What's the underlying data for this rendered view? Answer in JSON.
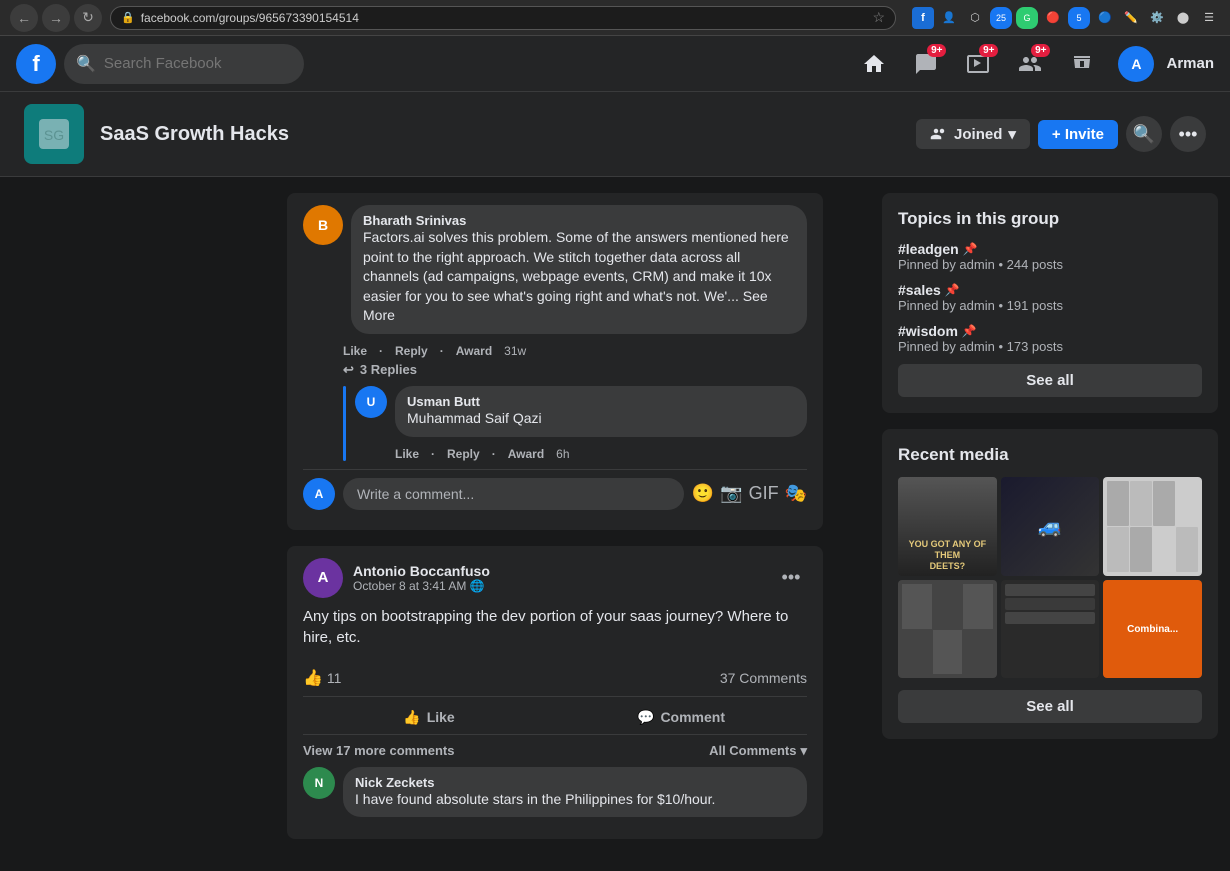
{
  "browser": {
    "url": "facebook.com/groups/965673390154514",
    "back": "←",
    "forward": "→",
    "refresh": "↻"
  },
  "nav": {
    "logo": "f",
    "search_placeholder": "Search Facebook",
    "badges": {
      "messenger": "9+",
      "watch": "9+",
      "groups": "9+",
      "gaming": ""
    },
    "user_name": "Arman"
  },
  "group": {
    "name": "SaaS Growth Hacks",
    "joined_label": "Joined",
    "invite_label": "+ Invite"
  },
  "topics": {
    "title": "Topics in this group",
    "items": [
      {
        "name": "#leadgen",
        "meta": "Pinned by admin • 244 posts"
      },
      {
        "name": "#sales",
        "meta": "Pinned by admin • 191 posts"
      },
      {
        "name": "#wisdom",
        "meta": "Pinned by admin • 173 posts"
      }
    ],
    "see_all": "See all"
  },
  "recent_media": {
    "title": "Recent media",
    "see_all": "See all"
  },
  "comments_section": {
    "author_name": "Bharath Srinivas",
    "comment_text": "Factors.ai solves this problem. Some of the answers mentioned here point to the right approach. We stitch together data across all channels (ad campaigns, webpage events, CRM) and make it 10x easier for you to see what's going right and what's not. We'...",
    "see_more": "See More",
    "like": "Like",
    "reply": "Reply",
    "award": "Award",
    "time": "31w",
    "replies_count": "3 Replies",
    "nested_author": "Usman Butt",
    "nested_name2": "Muhammad Saif Qazi",
    "nested_time": "6h",
    "write_comment_placeholder": "Write a comment..."
  },
  "post": {
    "author": "Antonio Boccanfuso",
    "timestamp": "October 8 at 3:41 AM",
    "privacy": "🌐",
    "text": "Any tips on bootstrapping the dev portion of your saas journey? Where to hire, etc.",
    "reactions": "11",
    "comments_count": "37 Comments",
    "like_label": "Like",
    "comment_label": "Comment",
    "view_more": "View 17 more comments",
    "all_comments": "All Comments",
    "commenter_name": "Nick Zeckets",
    "commenter_text": "I have found absolute stars in the Philippines for $10/hour."
  }
}
